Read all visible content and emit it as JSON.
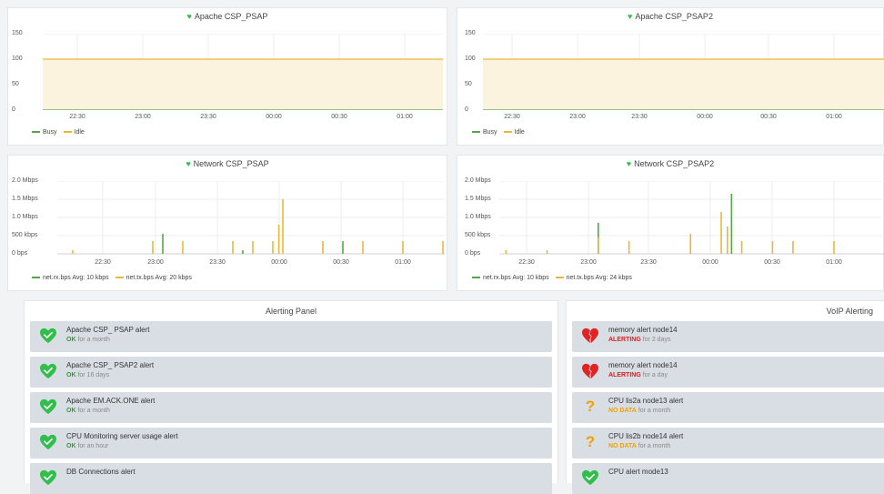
{
  "colors": {
    "busy": "#56a64b",
    "idle": "#e8b73a",
    "rx": "#56a64b",
    "tx": "#e8b73a",
    "ok": "#2aa02a",
    "alerting": "#e02020",
    "nodata": "#f0a000",
    "idle_fill": "#fbf3de"
  },
  "panels": {
    "apache1": {
      "title": "Apache CSP_PSAP",
      "y_ticks": [
        "150",
        "100",
        "50",
        "0"
      ],
      "x_ticks": [
        "22:30",
        "23:00",
        "23:30",
        "00:00",
        "00:30",
        "01:00"
      ],
      "legend": [
        "Busy",
        "Idle"
      ]
    },
    "apache2": {
      "title": "Apache CSP_PSAP2",
      "y_ticks": [
        "150",
        "100",
        "50",
        "0"
      ],
      "x_ticks": [
        "22:30",
        "23:00",
        "23:30",
        "00:00",
        "00:30",
        "01:00"
      ],
      "legend": [
        "Busy",
        "Idle"
      ]
    },
    "net1": {
      "title": "Network CSP_PSAP",
      "y_ticks": [
        "2.0 Mbps",
        "1.5 Mbps",
        "1.0 Mbps",
        "500 kbps",
        "0 bps"
      ],
      "x_ticks": [
        "22:30",
        "23:00",
        "23:30",
        "00:00",
        "00:30",
        "01:00"
      ],
      "legend": [
        {
          "name": "net.rx.bps",
          "avg": "Avg: 10 kbps"
        },
        {
          "name": "net.tx.bps",
          "avg": "Avg: 20 kbps"
        }
      ]
    },
    "net2": {
      "title": "Network CSP_PSAP2",
      "y_ticks": [
        "2.0 Mbps",
        "1.5 Mbps",
        "1.0 Mbps",
        "500 kbps",
        "0 bps"
      ],
      "x_ticks": [
        "22:30",
        "23:00",
        "23:30",
        "00:00",
        "00:30",
        "01:00"
      ],
      "legend": [
        {
          "name": "net.rx.bps",
          "avg": "Avg: 10 kbps"
        },
        {
          "name": "net.tx.bps",
          "avg": "Avg: 24 kbps"
        }
      ]
    }
  },
  "chart_data": [
    {
      "type": "area",
      "title": "Apache CSP_PSAP",
      "x": [
        "22:30",
        "23:00",
        "23:30",
        "00:00",
        "00:30",
        "01:00"
      ],
      "ylim": [
        0,
        150
      ],
      "series": [
        {
          "name": "Busy",
          "values": [
            0,
            0,
            0,
            0,
            0,
            0
          ]
        },
        {
          "name": "Idle",
          "values": [
            100,
            100,
            100,
            100,
            100,
            100
          ]
        }
      ]
    },
    {
      "type": "area",
      "title": "Apache CSP_PSAP2",
      "x": [
        "22:30",
        "23:00",
        "23:30",
        "00:00",
        "00:30",
        "01:00"
      ],
      "ylim": [
        0,
        150
      ],
      "series": [
        {
          "name": "Busy",
          "values": [
            0,
            0,
            0,
            0,
            0,
            0
          ]
        },
        {
          "name": "Idle",
          "values": [
            100,
            100,
            100,
            100,
            100,
            100
          ]
        }
      ]
    },
    {
      "type": "bar",
      "title": "Network CSP_PSAP",
      "ylim_bps": [
        0,
        2000000
      ],
      "series": [
        {
          "name": "net.rx.bps",
          "points": [
            {
              "t": "23:00",
              "v": 550000
            },
            {
              "t": "23:40",
              "v": 100000
            },
            {
              "t": "00:30",
              "v": 350000
            }
          ]
        },
        {
          "name": "net.tx.bps",
          "points": [
            {
              "t": "22:15",
              "v": 100000
            },
            {
              "t": "22:55",
              "v": 350000
            },
            {
              "t": "23:10",
              "v": 350000
            },
            {
              "t": "23:35",
              "v": 350000
            },
            {
              "t": "23:45",
              "v": 350000
            },
            {
              "t": "23:55",
              "v": 350000
            },
            {
              "t": "23:58",
              "v": 800000
            },
            {
              "t": "00:00",
              "v": 1500000
            },
            {
              "t": "00:20",
              "v": 350000
            },
            {
              "t": "00:40",
              "v": 350000
            },
            {
              "t": "01:00",
              "v": 350000
            },
            {
              "t": "01:20",
              "v": 350000
            }
          ]
        }
      ]
    },
    {
      "type": "bar",
      "title": "Network CSP_PSAP2",
      "ylim_bps": [
        0,
        2000000
      ],
      "series": [
        {
          "name": "net.rx.bps",
          "points": [
            {
              "t": "23:05",
              "v": 850000
            },
            {
              "t": "00:10",
              "v": 1650000
            }
          ]
        },
        {
          "name": "net.tx.bps",
          "points": [
            {
              "t": "22:20",
              "v": 100000
            },
            {
              "t": "22:40",
              "v": 100000
            },
            {
              "t": "23:05",
              "v": 450000
            },
            {
              "t": "23:20",
              "v": 350000
            },
            {
              "t": "23:50",
              "v": 550000
            },
            {
              "t": "00:05",
              "v": 1150000
            },
            {
              "t": "00:08",
              "v": 750000
            },
            {
              "t": "00:15",
              "v": 350000
            },
            {
              "t": "00:30",
              "v": 350000
            },
            {
              "t": "00:40",
              "v": 350000
            },
            {
              "t": "01:00",
              "v": 350000
            }
          ]
        }
      ]
    }
  ],
  "alerting_panel": {
    "title": "Alerting Panel",
    "alerts": [
      {
        "name": "Apache CSP_ PSAP alert",
        "state": "OK",
        "state_class": "st-ok",
        "duration": "for a month",
        "icon": "heart-icon"
      },
      {
        "name": "Apache CSP_ PSAP2 alert",
        "state": "OK",
        "state_class": "st-ok",
        "duration": "for 16 days",
        "icon": "heart-icon"
      },
      {
        "name": "Apache EM.ACK.ONE alert",
        "state": "OK",
        "state_class": "st-ok",
        "duration": "for a month",
        "icon": "heart-icon"
      },
      {
        "name": "CPU Monitoring server usage alert",
        "state": "OK",
        "state_class": "st-ok",
        "duration": "for an hour",
        "icon": "heart-icon"
      },
      {
        "name": "DB Connections alert",
        "state": "",
        "state_class": "st-ok",
        "duration": "",
        "icon": "heart-icon"
      }
    ]
  },
  "voip_panel": {
    "title": "VoIP Alerting",
    "alerts": [
      {
        "name": "memory alert node14",
        "state": "ALERTING",
        "state_class": "st-alerting",
        "duration": "for 2 days",
        "icon": "broken-heart-icon"
      },
      {
        "name": "memory alert node14",
        "state": "ALERTING",
        "state_class": "st-alerting",
        "duration": "for a day",
        "icon": "broken-heart-icon"
      },
      {
        "name": "CPU lis2a node13 alert",
        "state": "NO DATA",
        "state_class": "st-nodata",
        "duration": "for a month",
        "icon": "question-icon"
      },
      {
        "name": "CPU lis2b node14 alert",
        "state": "NO DATA",
        "state_class": "st-nodata",
        "duration": "for a month",
        "icon": "question-icon"
      },
      {
        "name": "CPU alert mode13",
        "state": "",
        "state_class": "st-ok",
        "duration": "",
        "icon": "heart-icon"
      }
    ]
  }
}
